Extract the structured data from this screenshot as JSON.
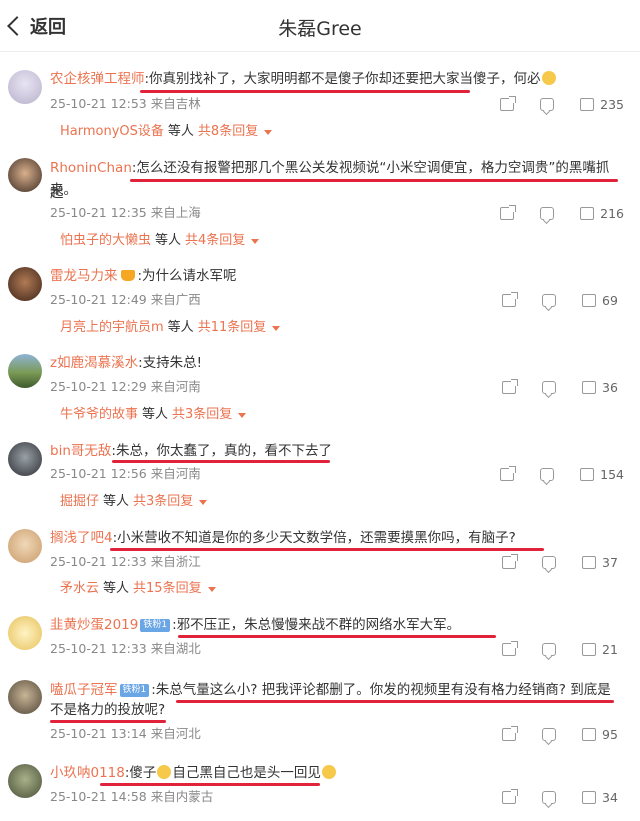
{
  "header": {
    "back_label": "返回",
    "title": "朱磊Gree"
  },
  "comments": [
    {
      "user": "农企核弹工程师",
      "badge": "",
      "text": ":你真别找补了，大家明明都不是傻子你却还要把大家当傻子，何必",
      "text2": "",
      "time": "25-10-21 12:53",
      "location": "来自吉林",
      "likes": "235",
      "reply_user": "HarmonyOS设备",
      "reply_mid": "等人",
      "reply_count": "共8条回复"
    },
    {
      "user": "RhoninChan",
      "badge": "",
      "text": ":怎么还没有报警把那几个黑公关发视频说“小米空调便宜，格力空调贵”的黑嘴抓起",
      "text2": "来。",
      "time": "25-10-21 12:35",
      "location": "来自上海",
      "likes": "216",
      "reply_user": "怕虫子的大懒虫",
      "reply_mid": "等人",
      "reply_count": "共4条回复"
    },
    {
      "user": "雷龙马力来",
      "badge": "",
      "text": ":为什么请水军呢",
      "text2": "",
      "time": "25-10-21 12:49",
      "location": "来自广西",
      "likes": "69",
      "reply_user": "月亮上的宇航员m",
      "reply_mid": "等人",
      "reply_count": "共11条回复"
    },
    {
      "user": "z如鹿渴慕溪水",
      "badge": "",
      "text": ":支持朱总!",
      "text2": "",
      "time": "25-10-21 12:29",
      "location": "来自河南",
      "likes": "36",
      "reply_user": "牛爷爷的故事",
      "reply_mid": "等人",
      "reply_count": "共3条回复"
    },
    {
      "user": "bin哥无敌",
      "badge": "",
      "text": ":朱总，你太蠢了，真的，看不下去了",
      "text2": "",
      "time": "25-10-21 12:56",
      "location": "来自河南",
      "likes": "154",
      "reply_user": "掘掘仔",
      "reply_mid": "等人",
      "reply_count": "共3条回复"
    },
    {
      "user": "搁浅了吧4",
      "badge": "",
      "text": ":小米营收不知道是你的多少天文数学倍，还需要摸黑你吗，有脑子?",
      "text2": "",
      "time": "25-10-21 12:33",
      "location": "来自浙江",
      "likes": "37",
      "reply_user": "矛水云",
      "reply_mid": "等人",
      "reply_count": "共15条回复"
    },
    {
      "user": "韭黄炒蛋2019",
      "badge": "铁粉1",
      "text": ":邪不压正，朱总慢慢来战不群的网络水军大军。",
      "text2": "",
      "time": "25-10-21 12:33",
      "location": "来自湖北",
      "likes": "21",
      "reply_user": "",
      "reply_mid": "",
      "reply_count": ""
    },
    {
      "user": "嗑瓜子冠军",
      "badge": "铁粉1",
      "text": ":朱总气量这么小? 把我评论都删了。你发的视频里有没有格力经销商? 到底是",
      "text2": "不是格力的投放呢?",
      "time": "25-10-21 13:14",
      "location": "来自河北",
      "likes": "95",
      "reply_user": "",
      "reply_mid": "",
      "reply_count": ""
    },
    {
      "user": "小玖呐0118",
      "badge": "",
      "text": ":傻子",
      "text_after": "自己黑自己也是头一回见",
      "text2": "",
      "time": "25-10-21 14:58",
      "location": "来自内蒙古",
      "likes": "34",
      "reply_user": "",
      "reply_mid": "",
      "reply_count": ""
    }
  ],
  "colors": {
    "accent": "#eb7350",
    "underline": "#e0233a",
    "meta": "#888888"
  },
  "icons": [
    "share-icon",
    "comment-icon",
    "like-icon"
  ]
}
